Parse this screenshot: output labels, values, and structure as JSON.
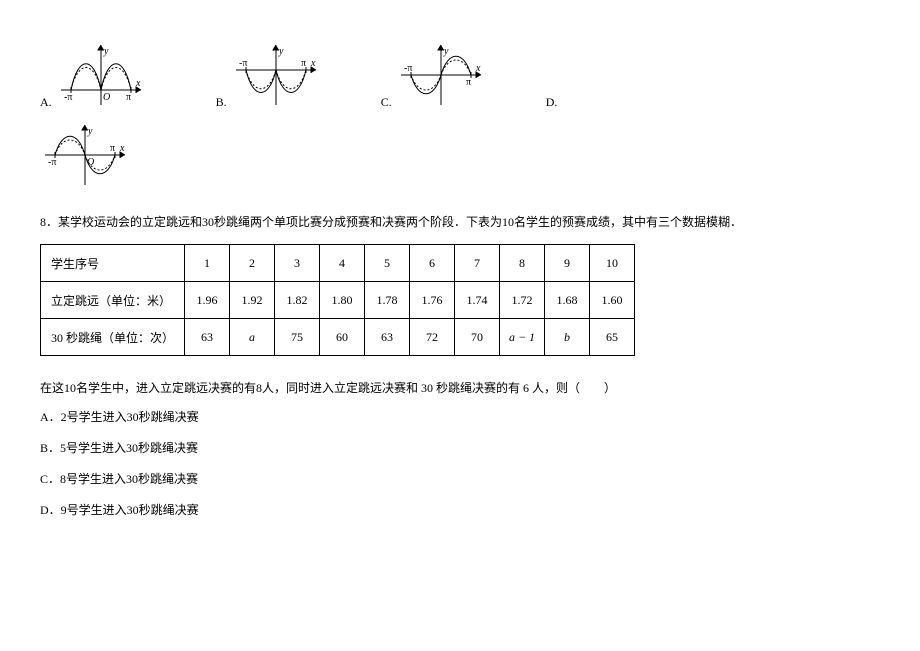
{
  "graph_options": {
    "A": "A.",
    "B": "B.",
    "C": "C.",
    "D": "D."
  },
  "axis": {
    "y": "y",
    "x": "x",
    "O": "O",
    "pi": "π",
    "neg_pi": "-π"
  },
  "q8_num": "8．",
  "q8_text": "某学校运动会的立定跳远和30秒跳绳两个单项比赛分成预赛和决赛两个阶段．下表为10名学生的预赛成绩，其中有三个数据模糊．",
  "table": {
    "row1_hdr": "学生序号",
    "row1": [
      "1",
      "2",
      "3",
      "4",
      "5",
      "6",
      "7",
      "8",
      "9",
      "10"
    ],
    "row2_hdr": "立定跳远（单位：米）",
    "row2": [
      "1.96",
      "1.92",
      "1.82",
      "1.80",
      "1.78",
      "1.76",
      "1.74",
      "1.72",
      "1.68",
      "1.60"
    ],
    "row3_hdr": "30 秒跳绳（单位：次）",
    "row3": [
      "63",
      "a",
      "75",
      "60",
      "63",
      "72",
      "70",
      "a − 1",
      "b",
      "65"
    ]
  },
  "after_table": "在这10名学生中，进入立定跳远决赛的有8人，同时进入立定跳远决赛和 30 秒跳绳决赛的有 6 人，则（　　）",
  "opts": {
    "A": "A．2号学生进入30秒跳绳决赛",
    "B": "B．5号学生进入30秒跳绳决赛",
    "C": "C．8号学生进入30秒跳绳决赛",
    "D": "D．9号学生进入30秒跳绳决赛"
  },
  "chart_data": [
    {
      "type": "line",
      "option": "A",
      "desc": "Two upward humps on [-π,0] and [0,π], symmetric about y-axis, both above x-axis",
      "xrange": [
        -3.14,
        3.14
      ]
    },
    {
      "type": "line",
      "option": "B",
      "desc": "Curve on [-π,π] below x-axis with two downward humps flanking origin, dashed envelope hints",
      "xrange": [
        -3.14,
        3.14
      ]
    },
    {
      "type": "line",
      "option": "C",
      "desc": "Left hump below x-axis on [-π,0], right hump above on [0,π] (odd-like)",
      "xrange": [
        -3.14,
        3.14
      ]
    },
    {
      "type": "line",
      "option": "D",
      "desc": "Left hump above x-axis on [-π,0], right hump below on [0,π]",
      "xrange": [
        -3.14,
        3.14
      ]
    }
  ]
}
